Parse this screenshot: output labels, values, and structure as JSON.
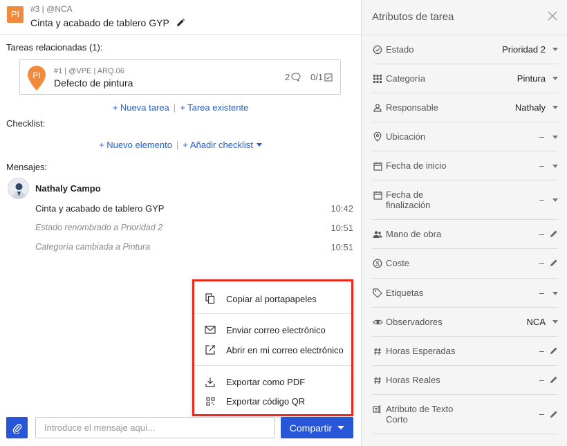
{
  "header": {
    "badge": "PI",
    "meta": "#3 | @NCA",
    "title": "Cinta y acabado de tablero GYP"
  },
  "related": {
    "label": "Tareas relacionadas (1):",
    "card": {
      "badge": "PI",
      "meta": "#1 | @VPE | ARQ.06",
      "title": "Defecto de pintura",
      "comments": "2",
      "checklist": "0/1"
    },
    "new_task": "+ Nueva tarea",
    "existing_task": "+ Tarea existente"
  },
  "checklist": {
    "label": "Checklist:",
    "new_item": "+ Nuevo elemento",
    "add_checklist": "+ Añadir checklist"
  },
  "messages": {
    "label": "Mensajes:",
    "author": "Nathaly Campo",
    "items": [
      {
        "text": "Cinta y acabado de tablero GYP",
        "time": "10:42"
      },
      {
        "text": "Estado renombrado a Prioridad 2",
        "time": "10:51"
      },
      {
        "text": "Categoría cambiada a Pintura",
        "time": "10:51"
      }
    ]
  },
  "share_menu": {
    "copy": "Copiar al portapapeles",
    "send_email": "Enviar correo electrónico",
    "open_email": "Abrir en mi correo electrónico",
    "export_pdf": "Exportar como PDF",
    "export_qr": "Exportar código QR"
  },
  "composer": {
    "placeholder": "Introduce el mensaje aquí...",
    "share": "Compartir"
  },
  "panel": {
    "title": "Atributos de tarea",
    "attributes": [
      {
        "label": "Estado",
        "value": "Prioridad 2",
        "icon": "status-icon"
      },
      {
        "label": "Categoría",
        "value": "Pintura",
        "icon": "grid-icon"
      },
      {
        "label": "Responsable",
        "value": "Nathaly",
        "icon": "person-icon"
      },
      {
        "label": "Ubicación",
        "value": "–",
        "icon": "location-icon"
      },
      {
        "label": "Fecha de inicio",
        "value": "–",
        "icon": "calendar-icon"
      },
      {
        "label": "Fecha de finalización",
        "value": "–",
        "icon": "calendar-icon"
      },
      {
        "label": "Mano de obra",
        "value": "–",
        "icon": "people-icon"
      },
      {
        "label": "Coste",
        "value": "–",
        "icon": "dollar-icon"
      },
      {
        "label": "Etiquetas",
        "value": "–",
        "icon": "tag-icon"
      },
      {
        "label": "Observadores",
        "value": "NCA",
        "icon": "eye-icon"
      },
      {
        "label": "Horas Esperadas",
        "value": "–",
        "icon": "hash-icon"
      },
      {
        "label": "Horas Reales",
        "value": "–",
        "icon": "hash-icon"
      },
      {
        "label": "Atributo de Texto Corto",
        "value": "–",
        "icon": "text-attr-icon"
      }
    ]
  }
}
